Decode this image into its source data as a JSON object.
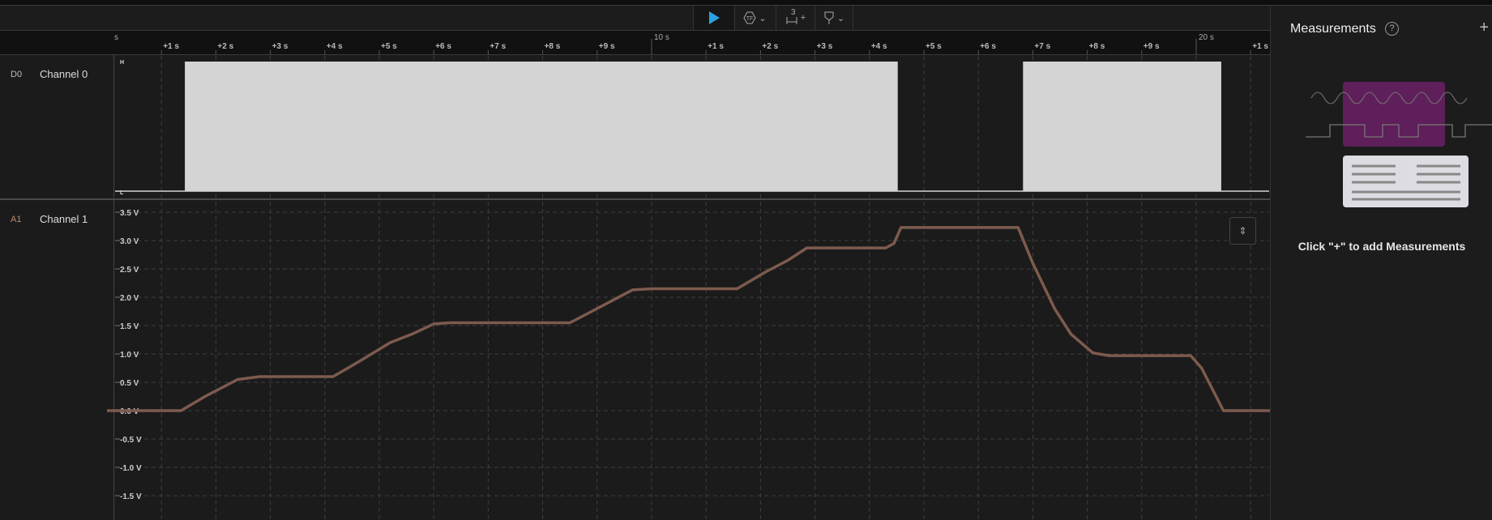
{
  "toolbar": {
    "play": "play-icon",
    "trigger": "trigger-icon",
    "markers_count": "3",
    "markers_plus": "+",
    "measure": "measure-icon",
    "chevron": "⌄"
  },
  "time_axis": {
    "first_cut": "s",
    "major": [
      {
        "t": 10,
        "label": "10 s"
      },
      {
        "t": 20,
        "label": "20 s"
      }
    ],
    "minor_labels": [
      "+1 s",
      "+2 s",
      "+3 s",
      "+4 s",
      "+5 s",
      "+6 s",
      "+7 s",
      "+8 s",
      "+9 s"
    ]
  },
  "channels": [
    {
      "id": "D0",
      "name": "Channel 0",
      "id_color": "#bdbdbd"
    },
    {
      "id": "A1",
      "name": "Channel 1",
      "id_color": "#c08a6e"
    }
  ],
  "digital": {
    "high_label": "H",
    "low_label": "L",
    "pulses": [
      [
        1.43,
        14.52
      ],
      [
        16.82,
        20.46
      ]
    ]
  },
  "analog": {
    "color": "#7d5b4d",
    "yticks": [
      "3.5 V",
      "3.0 V",
      "2.5 V",
      "2.0 V",
      "1.5 V",
      "1.0 V",
      "0.5 V",
      "0.0 V",
      "-0.5 V",
      "-1.0 V",
      "-1.5 V"
    ],
    "ytick_values": [
      3.5,
      3.0,
      2.5,
      2.0,
      1.5,
      1.0,
      0.5,
      0.0,
      -0.5,
      -1.0,
      -1.5
    ],
    "points": [
      [
        0,
        0
      ],
      [
        1.36,
        0
      ],
      [
        1.8,
        0.25
      ],
      [
        2.4,
        0.55
      ],
      [
        2.8,
        0.6
      ],
      [
        4.15,
        0.6
      ],
      [
        4.6,
        0.85
      ],
      [
        5.2,
        1.2
      ],
      [
        5.6,
        1.35
      ],
      [
        6.0,
        1.53
      ],
      [
        6.3,
        1.55
      ],
      [
        8.5,
        1.55
      ],
      [
        8.9,
        1.75
      ],
      [
        9.65,
        2.13
      ],
      [
        10,
        2.15
      ],
      [
        11.57,
        2.15
      ],
      [
        12.1,
        2.45
      ],
      [
        12.5,
        2.65
      ],
      [
        12.85,
        2.87
      ],
      [
        14.3,
        2.87
      ],
      [
        14.45,
        2.95
      ],
      [
        14.58,
        3.23
      ],
      [
        16.73,
        3.23
      ],
      [
        17.0,
        2.6
      ],
      [
        17.4,
        1.8
      ],
      [
        17.7,
        1.35
      ],
      [
        18.1,
        1.02
      ],
      [
        18.4,
        0.97
      ],
      [
        19.9,
        0.97
      ],
      [
        20.1,
        0.75
      ],
      [
        20.5,
        0
      ],
      [
        21.6,
        0
      ]
    ]
  },
  "sidebar": {
    "title": "Measurements",
    "help": "?",
    "add": "+",
    "hint": "Click \"+\" to add Measurements"
  },
  "fit_button": "⇕"
}
